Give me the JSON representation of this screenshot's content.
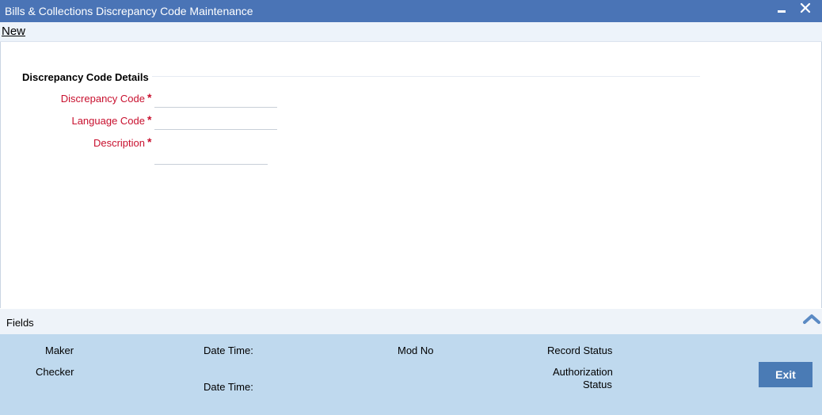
{
  "window": {
    "title": "Bills & Collections Discrepancy Code Maintenance",
    "minimize_glyph": "▬",
    "close_glyph": "✕"
  },
  "toolbar": {
    "new_label": "New"
  },
  "form": {
    "section_title": "Discrepancy Code Details",
    "required_marker": "*",
    "fields": [
      {
        "label": "Discrepancy Code",
        "value": "",
        "placeholder": ""
      },
      {
        "label": "Language Code",
        "value": "",
        "placeholder": ""
      },
      {
        "label": "Description",
        "value": "",
        "placeholder": ""
      }
    ]
  },
  "fields_bar": {
    "label": "Fields",
    "icon": "chevron-up-icon"
  },
  "footer": {
    "maker": "Maker",
    "checker": "Checker",
    "maker_date_time": "Date Time:",
    "checker_date_time": "Date Time:",
    "mod_no": "Mod No",
    "record_status": "Record Status",
    "authorization_status_line1": "Authorization",
    "authorization_status_line2": "Status",
    "exit_label": "Exit"
  },
  "colors": {
    "titlebar": "#4a74b6",
    "required_label": "#c8102e",
    "footer_bg": "#bfd9ee",
    "exit_button": "#4a7bb5"
  }
}
